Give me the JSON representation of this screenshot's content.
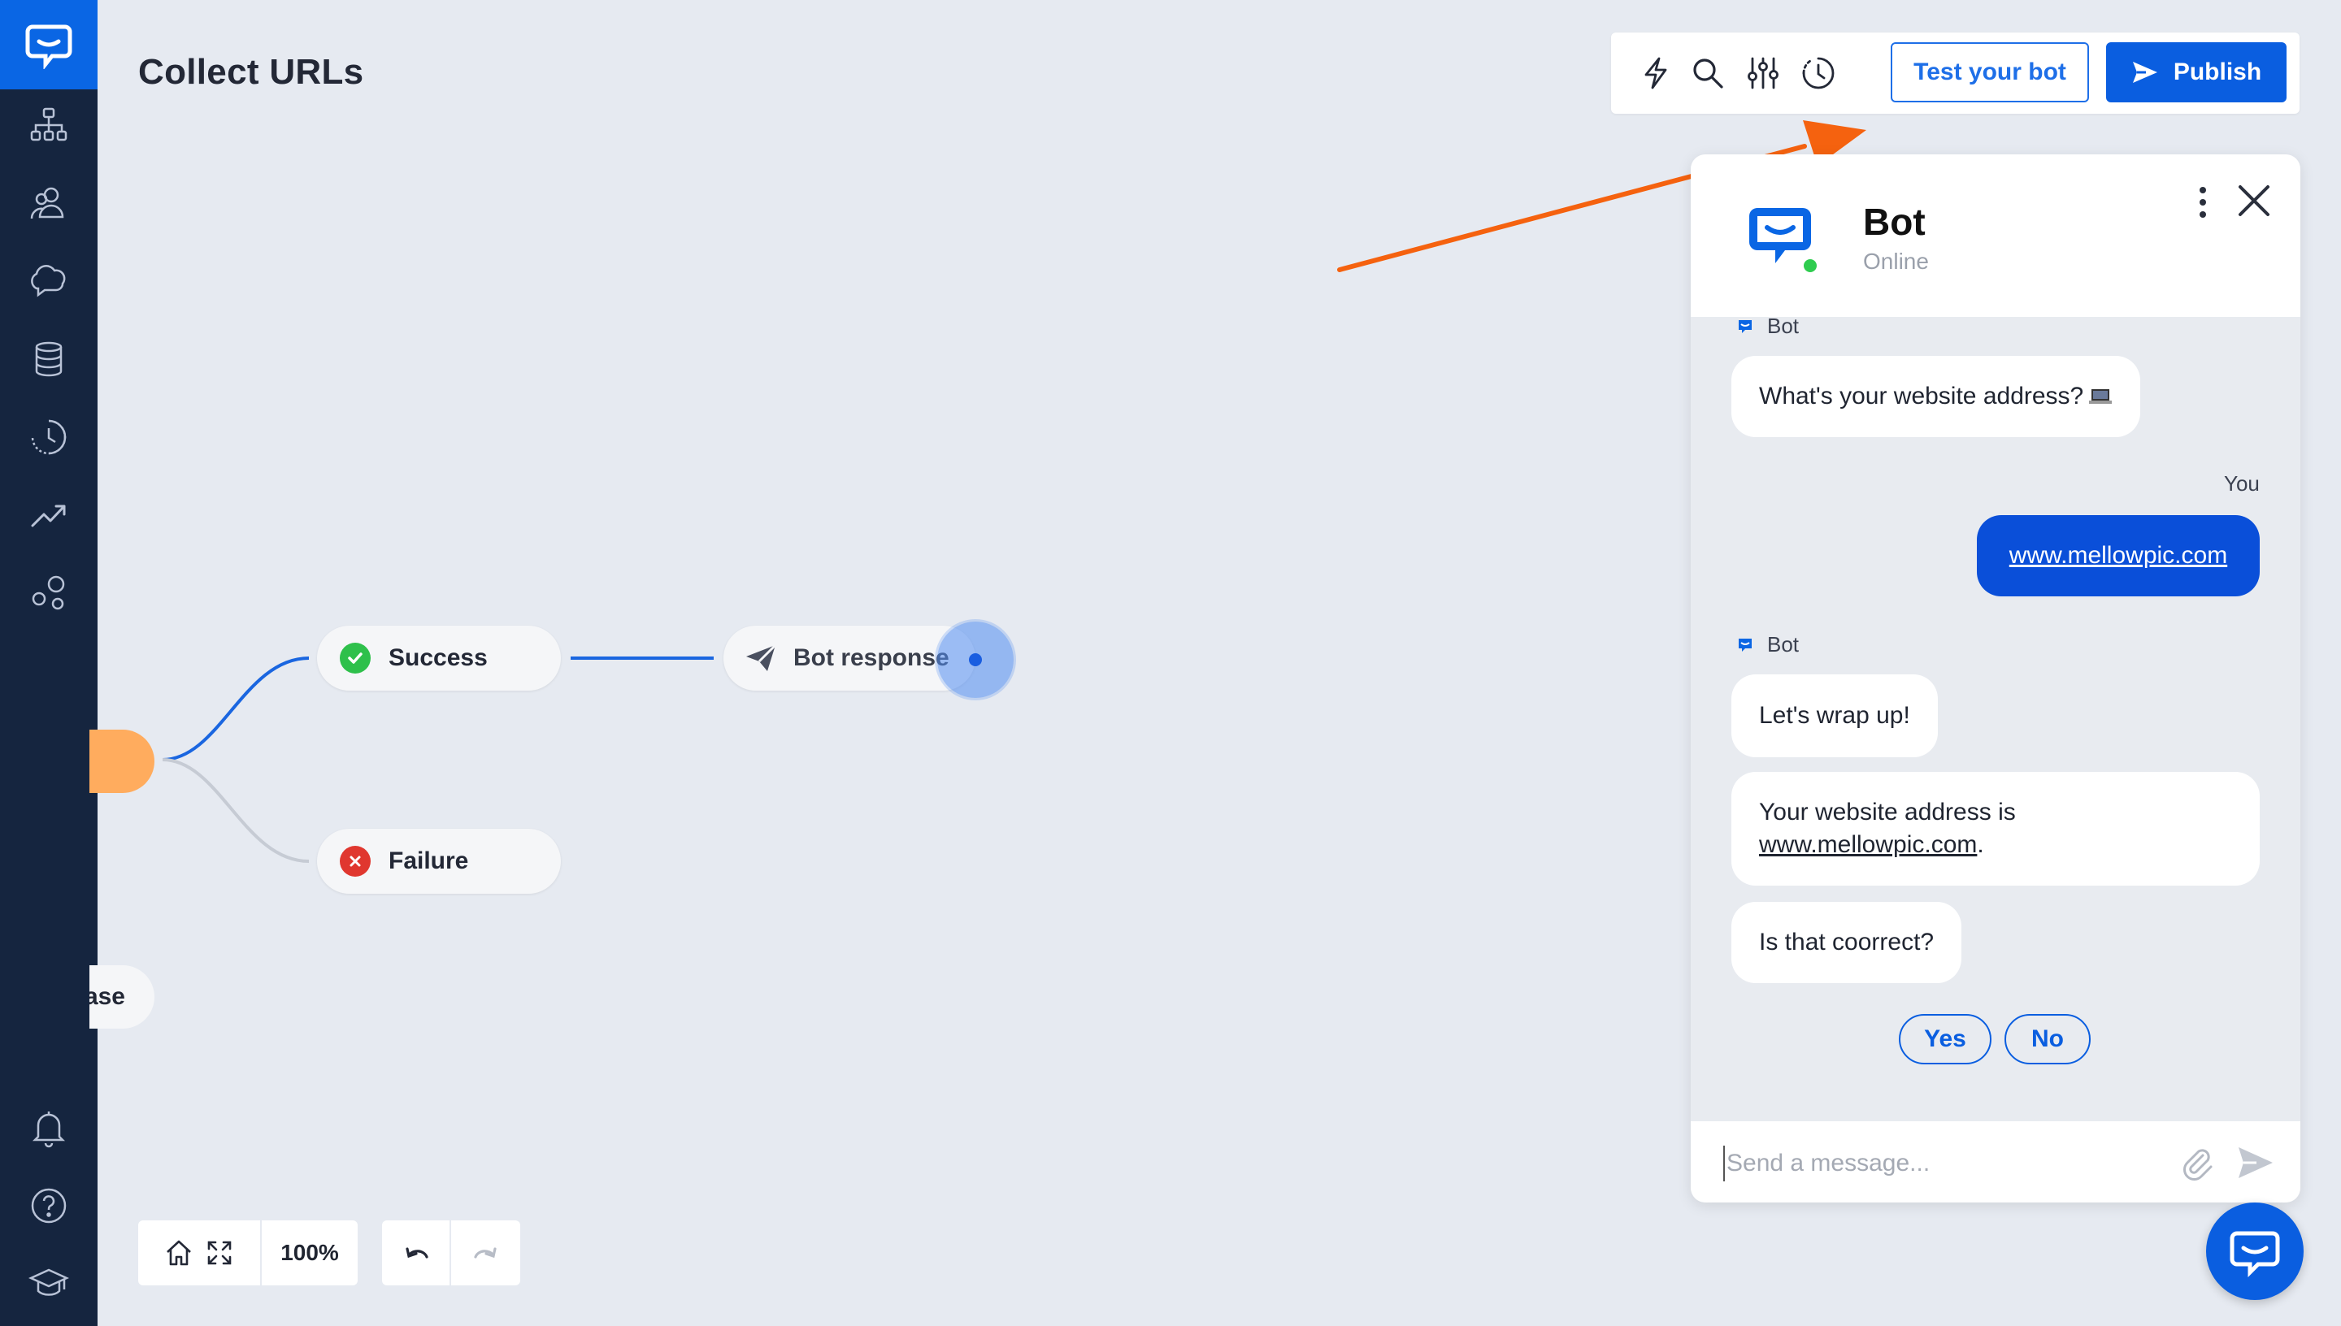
{
  "page": {
    "title": "Collect URLs"
  },
  "sidebar": {
    "items": [
      {
        "name": "flows",
        "icon": "sitemap-icon"
      },
      {
        "name": "audience",
        "icon": "users-icon"
      },
      {
        "name": "training",
        "icon": "chat-cloud-icon"
      },
      {
        "name": "data",
        "icon": "database-icon"
      },
      {
        "name": "history",
        "icon": "history-icon"
      },
      {
        "name": "reports",
        "icon": "trending-up-icon"
      },
      {
        "name": "integrations",
        "icon": "integrations-icon"
      },
      {
        "name": "notifications",
        "icon": "bell-icon"
      },
      {
        "name": "help",
        "icon": "help-icon"
      },
      {
        "name": "academy",
        "icon": "graduation-cap-icon"
      }
    ]
  },
  "toolbar": {
    "test_label": "Test your bot",
    "publish_label": "Publish"
  },
  "canvas": {
    "nodes": {
      "success": "Success",
      "failure": "Failure",
      "bot_response": "Bot response",
      "partial": "ase"
    },
    "zoom_level": "100%",
    "colors": {
      "accent": "#0a5ee0",
      "orange_node": "#ffac5e",
      "success": "#2ec04b",
      "failure": "#e0372f",
      "arrow": "#f5620f"
    }
  },
  "chat": {
    "bot_name": "Bot",
    "bot_status": "Online",
    "sender_bot": "Bot",
    "sender_you": "You",
    "messages": {
      "q1": "What's your website address?",
      "user_reply": "www.mellowpic.com",
      "wrap": "Let's wrap up!",
      "summary_prefix": "Your website address is",
      "summary_link": "www.mellowpic.com",
      "summary_suffix": ".",
      "confirm": "Is that coorrect?"
    },
    "quick_replies": {
      "yes": "Yes",
      "no": "No"
    },
    "composer_placeholder": "Send a message..."
  }
}
